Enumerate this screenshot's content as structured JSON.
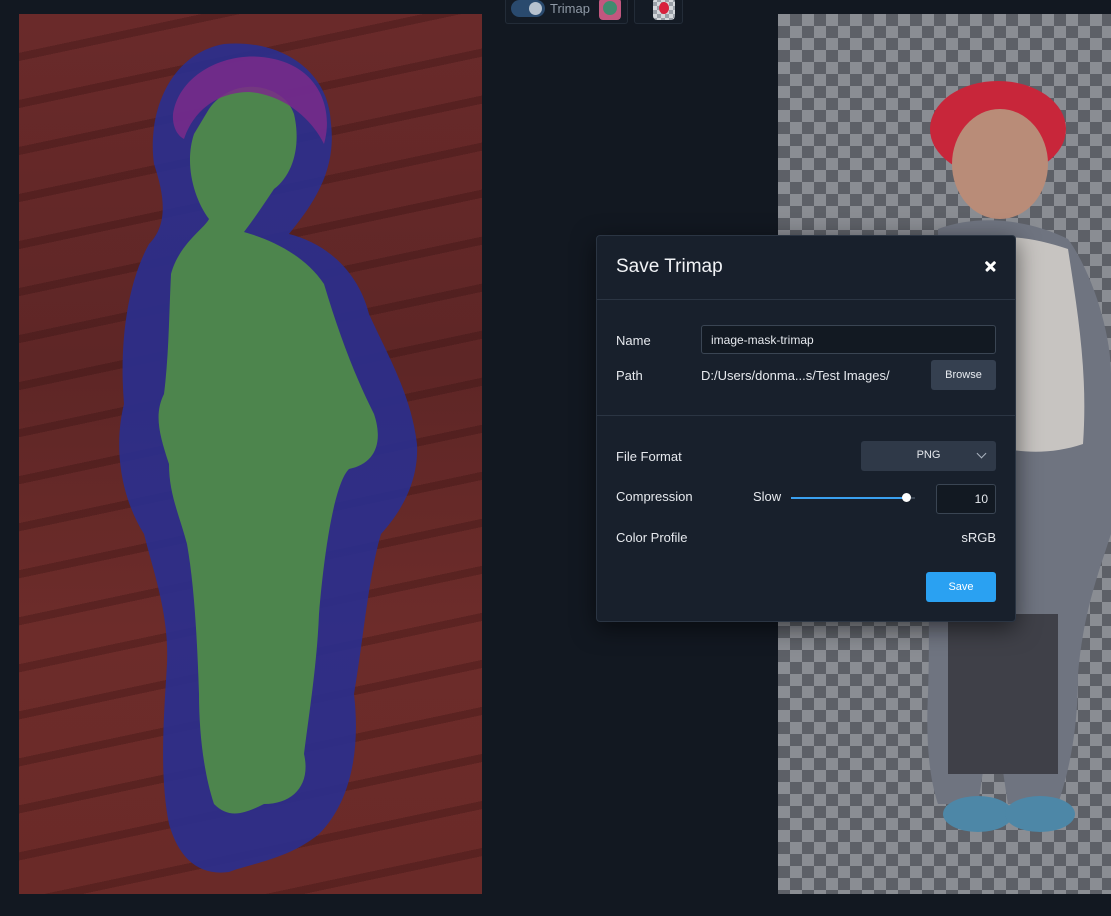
{
  "toolbar": {
    "trimap_toggle_label": "Trimap",
    "trimap_toggle_on": true,
    "thumbnails": [
      "trimap-thumbnail",
      "alpha-thumbnail"
    ]
  },
  "trimap_colors": {
    "background": "#6a2a2a",
    "unknown": "#2a2f8f",
    "foreground": "#4f8a4a"
  },
  "dialog": {
    "title": "Save Trimap",
    "close_icon": "close-icon",
    "name_label": "Name",
    "name_value": "image-mask-trimap",
    "path_label": "Path",
    "path_value": "D:/Users/donma...s/Test Images/",
    "browse_label": "Browse",
    "file_format_label": "File Format",
    "file_format_value": "PNG",
    "compression_label": "Compression",
    "compression_slider_label": "Slow",
    "compression_value": "10",
    "compression_fraction": 0.93,
    "color_profile_label": "Color Profile",
    "color_profile_value": "sRGB",
    "save_label": "Save",
    "accent_color": "#2aa1f2"
  }
}
